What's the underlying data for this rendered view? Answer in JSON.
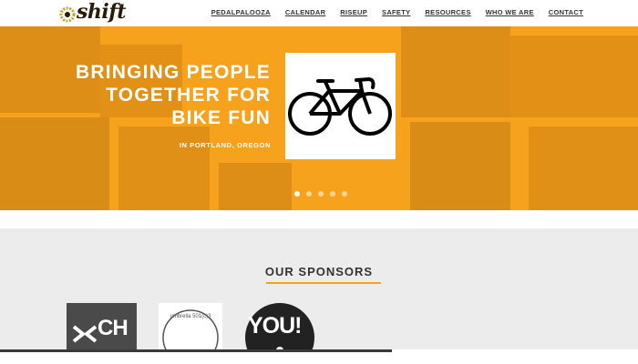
{
  "header": {
    "logo_text": "shift",
    "nav": [
      "PEDALPALOOZA",
      "CALENDAR",
      "RISEUP",
      "SAFETY",
      "RESOURCES",
      "WHO WE ARE",
      "CONTACT"
    ]
  },
  "hero": {
    "title_lines": [
      "BRINGING PEOPLE",
      "TOGETHER FOR",
      "BIKE FUN"
    ],
    "subtitle": "IN PORTLAND, OREGON",
    "image_icon": "bicycle-icon",
    "slides": 5,
    "active_slide": 1
  },
  "sponsors": {
    "heading": "OUR SPONSORS",
    "logos": [
      {
        "name": "ch-logo",
        "text": "CH"
      },
      {
        "name": "umbrella-logo",
        "text": "umbrella 501(c)3"
      },
      {
        "name": "you-logo",
        "text": "YOU!"
      }
    ]
  },
  "colors": {
    "accent": "#f7a21c",
    "nav_text": "#333333",
    "sponsor_bg": "#ececec"
  }
}
